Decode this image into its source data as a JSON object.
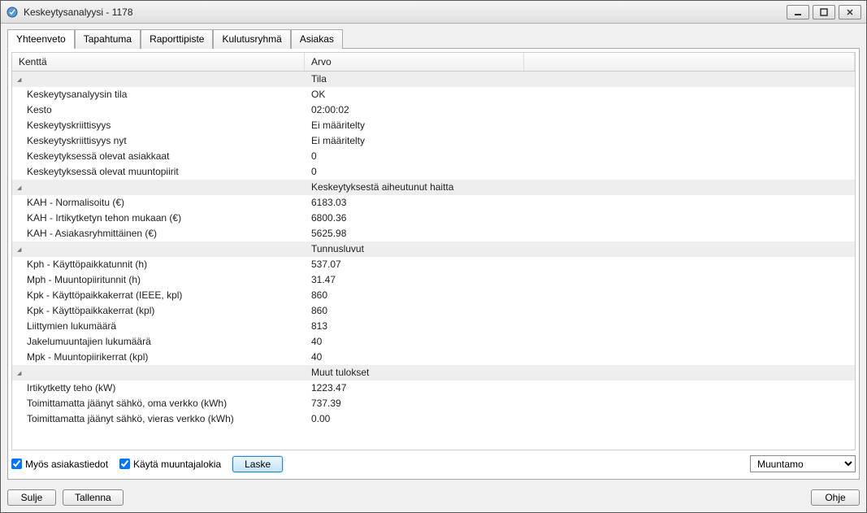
{
  "window": {
    "title": "Keskeytysanalyysi - 1178"
  },
  "tabs": [
    {
      "label": "Yhteenveto",
      "active": true
    },
    {
      "label": "Tapahtuma"
    },
    {
      "label": "Raporttipiste"
    },
    {
      "label": "Kulutusryhmä"
    },
    {
      "label": "Asiakas"
    }
  ],
  "columns": {
    "field": "Kenttä",
    "value": "Arvo"
  },
  "sections": [
    {
      "title": "Tila",
      "rows": [
        {
          "field": "Keskeytysanalyysin tila",
          "value": "OK"
        },
        {
          "field": "Kesto",
          "value": "02:00:02"
        },
        {
          "field": "Keskeytyskriittisyys",
          "value": "Ei määritelty"
        },
        {
          "field": "Keskeytyskriittisyys nyt",
          "value": "Ei määritelty"
        },
        {
          "field": "Keskeytyksessä olevat asiakkaat",
          "value": "0"
        },
        {
          "field": "Keskeytyksessä olevat muuntopiirit",
          "value": "0"
        }
      ]
    },
    {
      "title": "Keskeytyksestä aiheutunut haitta",
      "rows": [
        {
          "field": "KAH - Normalisoitu (€)",
          "value": "6183.03"
        },
        {
          "field": "KAH - Irtikytketyn tehon mukaan (€)",
          "value": "6800.36"
        },
        {
          "field": "KAH - Asiakasryhmittäinen (€)",
          "value": "5625.98"
        }
      ]
    },
    {
      "title": "Tunnusluvut",
      "rows": [
        {
          "field": "Kph - Käyttöpaikkatunnit (h)",
          "value": "537.07"
        },
        {
          "field": "Mph - Muuntopiiritunnit (h)",
          "value": "31.47"
        },
        {
          "field": "Kpk - Käyttöpaikkakerrat (IEEE, kpl)",
          "value": "860"
        },
        {
          "field": "Kpk - Käyttöpaikkakerrat (kpl)",
          "value": "860"
        },
        {
          "field": "Liittymien lukumäärä",
          "value": "813"
        },
        {
          "field": "Jakelumuuntajien lukumäärä",
          "value": "40"
        },
        {
          "field": "Mpk - Muuntopiirikerrat (kpl)",
          "value": "40"
        }
      ]
    },
    {
      "title": "Muut tulokset",
      "rows": [
        {
          "field": "Irtikytketty teho (kW)",
          "value": "1223.47"
        },
        {
          "field": "Toimittamatta jäänyt sähkö, oma verkko (kWh)",
          "value": "737.39"
        },
        {
          "field": "Toimittamatta jäänyt sähkö, vieras verkko (kWh)",
          "value": "0.00"
        }
      ]
    }
  ],
  "controls": {
    "chk_customer": "Myös asiakastiedot",
    "chk_transformer": "Käytä muuntajalokia",
    "calc": "Laske",
    "close": "Sulje",
    "save": "Tallenna",
    "help": "Ohje"
  },
  "dropdown": {
    "selected": "Muuntamo",
    "options": [
      "Muuntamo"
    ]
  }
}
